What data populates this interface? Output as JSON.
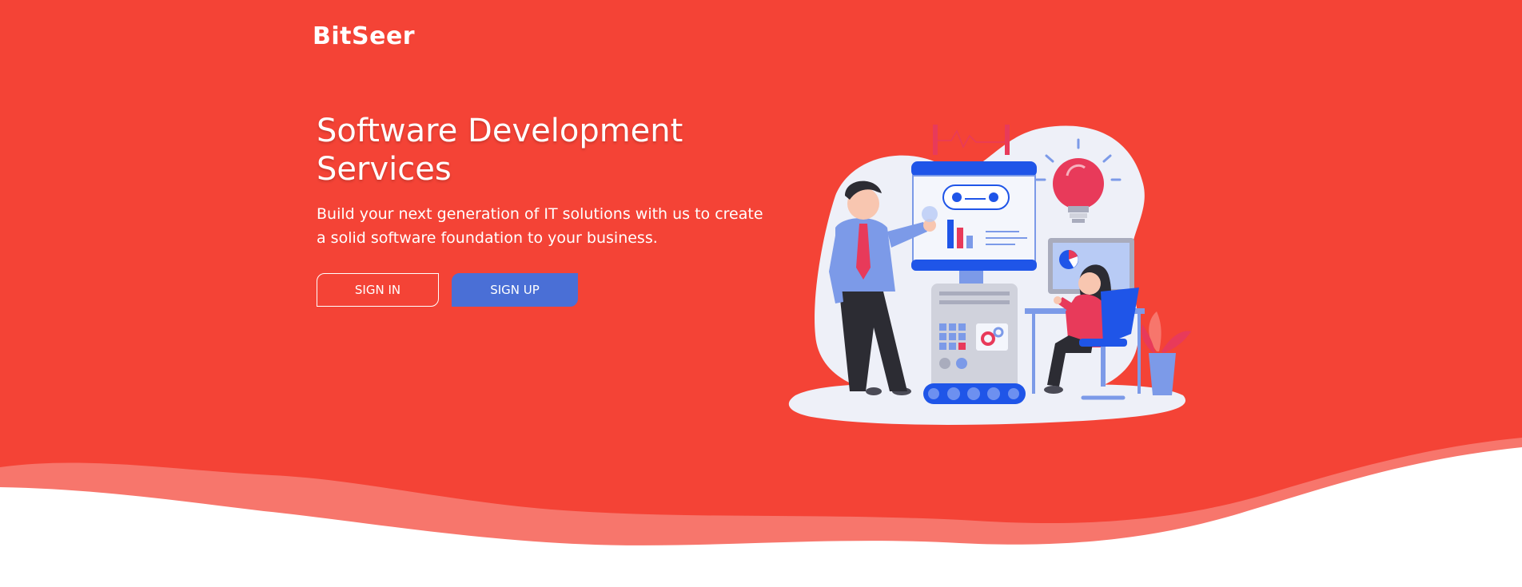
{
  "brand": {
    "logo_text": "BitSeer"
  },
  "hero": {
    "headline": "Software Development Services",
    "subtext": "Build your next generation of IT solutions with us to create a solid software foundation to your business."
  },
  "buttons": {
    "sign_in_label": "SIGN IN",
    "sign_up_label": "SIGN UP"
  },
  "colors": {
    "hero_red": "#f44336",
    "wave_light": "#f7766c",
    "button_blue": "#4a6fd6",
    "white": "#ffffff"
  },
  "illustration": {
    "icon": "software-development-illustration-icon"
  }
}
